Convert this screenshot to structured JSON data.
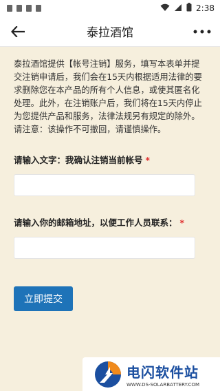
{
  "status_bar": {
    "time": "2:38"
  },
  "nav": {
    "title": "泰拉酒馆",
    "back_icon": "arrow-left-icon",
    "more_icon": "more-horizontal-icon"
  },
  "notice": {
    "line1": "泰拉酒馆提供【帐号注销】服务，填写本表单并提",
    "line2": "交注销申请后，我们会在15天内根据适用法律的要",
    "line3": "求删除您在本产品的所有个人信息，或使其匿名化",
    "line4": "处理。此外，在注销账户后，我们将在15天内停止",
    "line5": "为您提供产品和服务，法律法规另有规定的除外。",
    "line6": "请注意：该操作不可撤回，请谨慎操作。"
  },
  "form": {
    "field1_label": "请输入文字：我确认注销当前帐号",
    "field1_value": "",
    "field2_label": "请输入你的邮箱地址，以便工作人员联系：",
    "field2_value": "",
    "required_mark": "*",
    "submit_label": "立即提交"
  },
  "watermark": {
    "name": "电闪软件站",
    "url": "WWW.DS-SOLARBATTERY.COM"
  },
  "colors": {
    "background": "#f6efdd",
    "accent": "#1e73b8",
    "required": "#e02d2d"
  }
}
